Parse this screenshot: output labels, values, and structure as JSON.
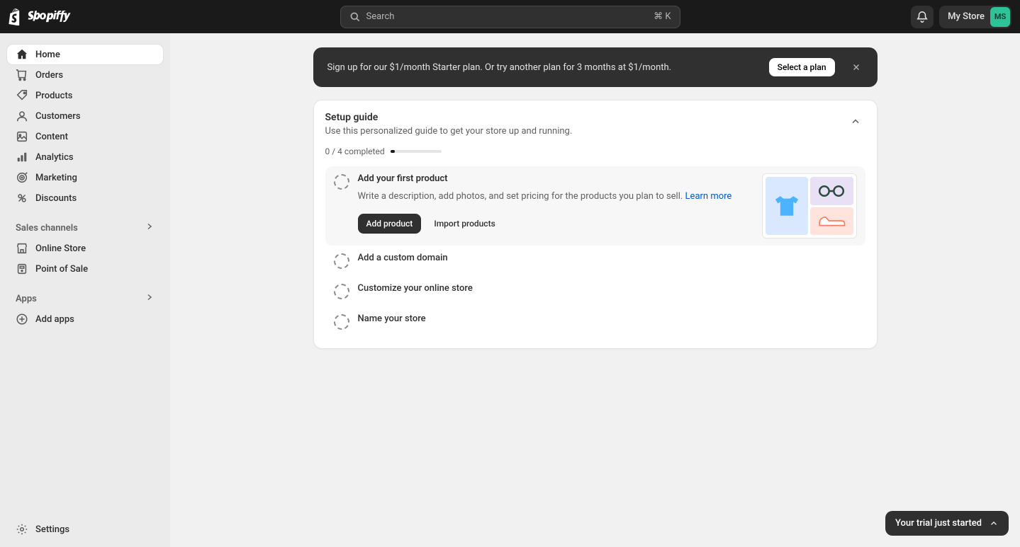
{
  "header": {
    "search_placeholder": "Search",
    "search_shortcut": "⌘ K",
    "store_name": "My Store",
    "store_initials": "MS"
  },
  "sidebar": {
    "items": [
      {
        "label": "Home",
        "icon": "home"
      },
      {
        "label": "Orders",
        "icon": "orders"
      },
      {
        "label": "Products",
        "icon": "products"
      },
      {
        "label": "Customers",
        "icon": "customers"
      },
      {
        "label": "Content",
        "icon": "content"
      },
      {
        "label": "Analytics",
        "icon": "analytics"
      },
      {
        "label": "Marketing",
        "icon": "marketing"
      },
      {
        "label": "Discounts",
        "icon": "discounts"
      }
    ],
    "sales_channels_label": "Sales channels",
    "sales_channels": [
      {
        "label": "Online Store",
        "icon": "store"
      },
      {
        "label": "Point of Sale",
        "icon": "pos"
      }
    ],
    "apps_label": "Apps",
    "add_apps_label": "Add apps",
    "settings_label": "Settings"
  },
  "banner": {
    "text": "Sign up for our $1/month Starter plan. Or try another plan for 3 months at $1/month.",
    "button": "Select a plan"
  },
  "setup": {
    "title": "Setup guide",
    "subtitle": "Use this personalized guide to get your store up and running.",
    "progress_text": "0 / 4 completed",
    "tasks": [
      {
        "title": "Add your first product",
        "desc": "Write a description, add photos, and set pricing for the products you plan to sell. ",
        "learn_more": "Learn more",
        "primary_btn": "Add product",
        "secondary_btn": "Import products"
      },
      {
        "title": "Add a custom domain"
      },
      {
        "title": "Customize your online store"
      },
      {
        "title": "Name your store"
      }
    ]
  },
  "trial_pill": "Your trial just started"
}
